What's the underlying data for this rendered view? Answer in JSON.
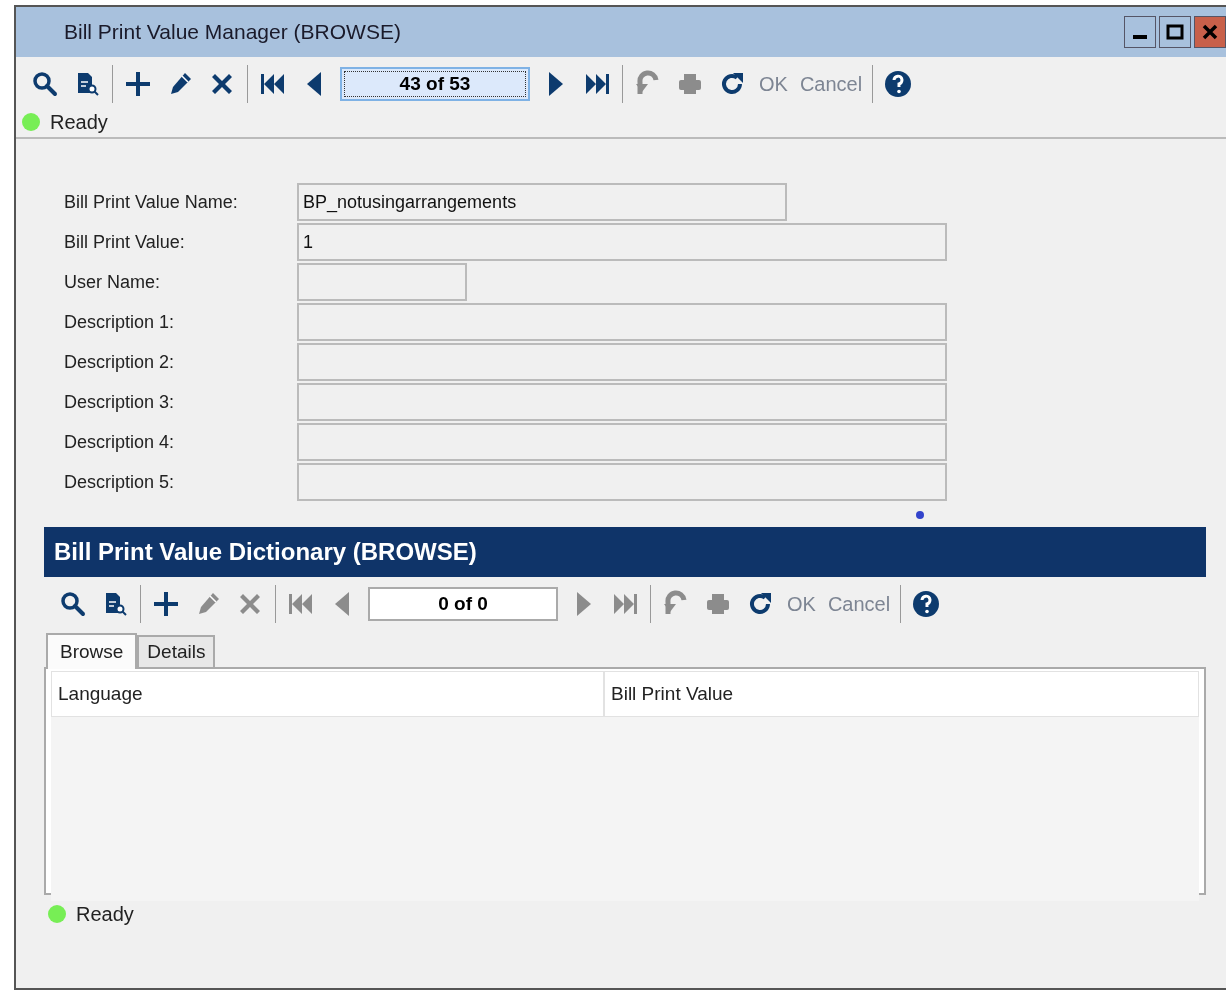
{
  "window": {
    "title": "Bill Print Value Manager (BROWSE)"
  },
  "toolbar": {
    "items": [
      {
        "kind": "search",
        "disabled": false
      },
      {
        "kind": "find-document",
        "disabled": false
      },
      {
        "kind": "separator"
      },
      {
        "kind": "add",
        "disabled": false
      },
      {
        "kind": "edit",
        "disabled": false
      },
      {
        "kind": "delete",
        "disabled": false
      },
      {
        "kind": "separator"
      },
      {
        "kind": "first",
        "disabled": false
      },
      {
        "kind": "previous",
        "disabled": false
      },
      {
        "kind": "record",
        "value": "43 of 53",
        "focused": true
      },
      {
        "kind": "next",
        "disabled": false
      },
      {
        "kind": "last",
        "disabled": false
      },
      {
        "kind": "separator"
      },
      {
        "kind": "undo",
        "disabled": true
      },
      {
        "kind": "print",
        "disabled": true
      },
      {
        "kind": "refresh",
        "disabled": false
      },
      {
        "kind": "text",
        "label": "OK",
        "disabled": true
      },
      {
        "kind": "text",
        "label": "Cancel",
        "disabled": true
      },
      {
        "kind": "separator"
      },
      {
        "kind": "help",
        "disabled": false
      }
    ]
  },
  "status": {
    "text": "Ready",
    "color": "#77ee55"
  },
  "form": {
    "fields": [
      {
        "label": "Bill Print Value Name:",
        "value": "BP_notusingarrangements"
      },
      {
        "label": "Bill Print Value:",
        "value": "1"
      },
      {
        "label": "User Name:"
      },
      {
        "label": "Description 1:"
      },
      {
        "label": "Description 2:"
      },
      {
        "label": "Description 3:"
      },
      {
        "label": "Description 4:"
      },
      {
        "label": "Description 5:"
      }
    ]
  },
  "dictionary": {
    "title": "Bill Print Value Dictionary (BROWSE)",
    "toolbar": {
      "items": [
        {
          "kind": "search",
          "disabled": false
        },
        {
          "kind": "find-document",
          "disabled": false
        },
        {
          "kind": "separator"
        },
        {
          "kind": "add",
          "disabled": false
        },
        {
          "kind": "edit",
          "disabled": true
        },
        {
          "kind": "delete",
          "disabled": true
        },
        {
          "kind": "separator"
        },
        {
          "kind": "first",
          "disabled": true
        },
        {
          "kind": "previous",
          "disabled": true
        },
        {
          "kind": "record",
          "value": "0 of 0",
          "focused": false
        },
        {
          "kind": "next",
          "disabled": true
        },
        {
          "kind": "last",
          "disabled": true
        },
        {
          "kind": "separator"
        },
        {
          "kind": "undo",
          "disabled": true
        },
        {
          "kind": "print",
          "disabled": true
        },
        {
          "kind": "refresh",
          "disabled": false
        },
        {
          "kind": "text",
          "label": "OK",
          "disabled": true
        },
        {
          "kind": "text",
          "label": "Cancel",
          "disabled": true
        },
        {
          "kind": "separator"
        },
        {
          "kind": "help",
          "disabled": false
        }
      ]
    },
    "tabs": [
      {
        "label": "Browse",
        "selected": true
      },
      {
        "label": "Details",
        "selected": false
      }
    ],
    "table": {
      "columns": [
        "Language",
        "Bill Print Value"
      ]
    },
    "status": {
      "text": "Ready",
      "color": "#77ee55"
    }
  }
}
